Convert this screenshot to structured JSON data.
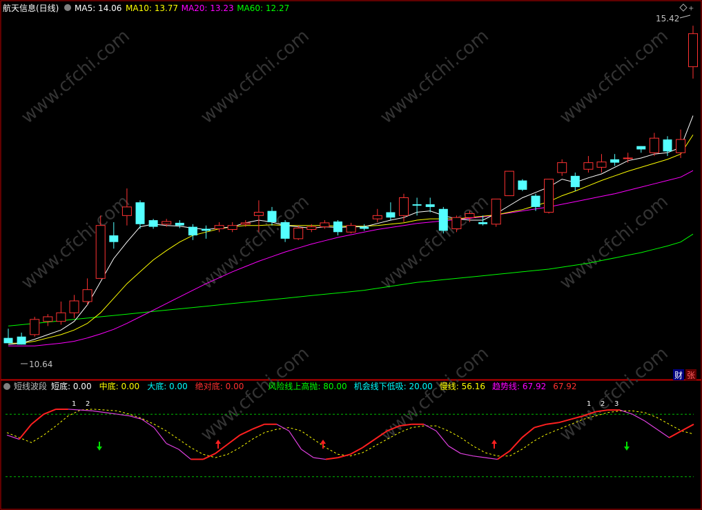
{
  "main_panel": {
    "title": "航天信息",
    "period": "(日线)",
    "ma_labels": [
      {
        "text": "MA5: 14.06",
        "color": "#ffffff"
      },
      {
        "text": "MA10: 13.77",
        "color": "#ffff00"
      },
      {
        "text": "MA20: 13.23",
        "color": "#ff00ff"
      },
      {
        "text": "MA60: 12.27",
        "color": "#00ff00"
      }
    ],
    "high_label": "15.42",
    "low_label": "10.64",
    "side_buttons": [
      "财",
      "张"
    ]
  },
  "sub_panel": {
    "title": "短线波段",
    "indicators": [
      {
        "text": "短底: 0.00",
        "color": "#ffffff"
      },
      {
        "text": "中底: 0.00",
        "color": "#ffff00"
      },
      {
        "text": "大底: 0.00",
        "color": "#00ffff"
      },
      {
        "text": "绝对底: 0.00",
        "color": "#ff3030"
      },
      {
        "text": "风险线上高抛: 80.00",
        "color": "#00ff00"
      },
      {
        "text": "机会线下低吸: 20.00",
        "color": "#00ffff"
      },
      {
        "text": "慢线: 56.16",
        "color": "#ffff00"
      },
      {
        "text": "趋势线: 67.92",
        "color": "#ff00ff"
      },
      {
        "text": "67.92",
        "color": "#ff3030"
      }
    ],
    "labels": [
      "1",
      "2",
      "1",
      "2",
      "3"
    ]
  },
  "watermark": "www.cfchi.com",
  "chart_data": {
    "type": "candlestick",
    "y_range": [
      10.3,
      15.6
    ],
    "candles": [
      [
        10.7,
        10.62,
        10.62,
        10.84
      ],
      [
        10.72,
        10.6,
        10.6,
        10.78
      ],
      [
        10.75,
        10.98,
        10.72,
        11.02
      ],
      [
        10.95,
        11.02,
        10.88,
        11.06
      ],
      [
        10.95,
        11.08,
        10.9,
        11.25
      ],
      [
        11.08,
        11.26,
        11.0,
        11.35
      ],
      [
        11.25,
        11.43,
        11.2,
        11.6
      ],
      [
        11.6,
        12.4,
        11.6,
        12.55
      ],
      [
        12.25,
        12.15,
        12.05,
        12.45
      ],
      [
        12.55,
        12.68,
        12.4,
        12.96
      ],
      [
        12.75,
        12.42,
        12.35,
        12.78
      ],
      [
        12.48,
        12.38,
        12.35,
        12.5
      ],
      [
        12.42,
        12.46,
        12.38,
        12.5
      ],
      [
        12.44,
        12.4,
        12.36,
        12.48
      ],
      [
        12.38,
        12.25,
        12.18,
        12.42
      ],
      [
        12.35,
        12.32,
        12.2,
        12.4
      ],
      [
        12.35,
        12.4,
        12.3,
        12.45
      ],
      [
        12.34,
        12.4,
        12.3,
        12.45
      ],
      [
        12.42,
        12.44,
        12.38,
        12.48
      ],
      [
        12.55,
        12.6,
        12.3,
        12.78
      ],
      [
        12.62,
        12.45,
        12.4,
        12.68
      ],
      [
        12.45,
        12.2,
        12.15,
        12.48
      ],
      [
        12.2,
        12.36,
        12.18,
        12.4
      ],
      [
        12.34,
        12.38,
        12.3,
        12.42
      ],
      [
        12.38,
        12.44,
        12.35,
        12.48
      ],
      [
        12.46,
        12.3,
        12.25,
        12.48
      ],
      [
        12.3,
        12.4,
        12.28,
        12.44
      ],
      [
        12.38,
        12.35,
        12.32,
        12.42
      ],
      [
        12.5,
        12.55,
        12.45,
        12.65
      ],
      [
        12.6,
        12.52,
        12.48,
        12.75
      ],
      [
        12.55,
        12.82,
        12.45,
        12.88
      ],
      [
        12.72,
        12.7,
        12.55,
        12.82
      ],
      [
        12.72,
        12.68,
        12.6,
        12.82
      ],
      [
        12.65,
        12.32,
        12.28,
        12.68
      ],
      [
        12.35,
        12.52,
        12.3,
        12.55
      ],
      [
        12.52,
        12.58,
        12.45,
        12.62
      ],
      [
        12.45,
        12.42,
        12.4,
        12.55
      ],
      [
        12.42,
        12.8,
        12.38,
        12.8
      ],
      [
        12.85,
        13.22,
        12.85,
        13.22
      ],
      [
        13.08,
        12.94,
        12.92,
        13.1
      ],
      [
        12.85,
        12.68,
        12.62,
        12.88
      ],
      [
        12.6,
        13.1,
        12.58,
        13.1
      ],
      [
        13.2,
        13.35,
        13.15,
        13.4
      ],
      [
        13.15,
        12.98,
        12.92,
        13.2
      ],
      [
        13.25,
        13.35,
        13.2,
        13.45
      ],
      [
        13.28,
        13.36,
        13.2,
        13.48
      ],
      [
        13.4,
        13.35,
        13.3,
        13.48
      ],
      [
        13.42,
        13.42,
        13.35,
        13.5
      ],
      [
        13.6,
        13.55,
        13.5,
        13.6
      ],
      [
        13.5,
        13.72,
        13.45,
        13.8
      ],
      [
        13.7,
        13.52,
        13.45,
        13.75
      ],
      [
        13.5,
        13.7,
        13.42,
        13.85
      ],
      [
        14.8,
        15.3,
        14.62,
        15.42
      ]
    ],
    "ma5": [
      10.6,
      10.62,
      10.68,
      10.75,
      10.82,
      10.95,
      11.2,
      11.55,
      11.9,
      12.15,
      12.38,
      12.42,
      12.4,
      12.39,
      12.36,
      12.34,
      12.36,
      12.38,
      12.44,
      12.48,
      12.45,
      12.4,
      12.38,
      12.36,
      12.38,
      12.37,
      12.38,
      12.38,
      12.43,
      12.48,
      12.52,
      12.6,
      12.62,
      12.55,
      12.5,
      12.48,
      12.48,
      12.58,
      12.7,
      12.82,
      12.9,
      12.98,
      13.1,
      13.05,
      13.12,
      13.18,
      13.28,
      13.38,
      13.42,
      13.48,
      13.5,
      13.58,
      14.06
    ],
    "ma10": [
      10.62,
      10.62,
      10.65,
      10.7,
      10.75,
      10.82,
      10.92,
      11.08,
      11.3,
      11.52,
      11.7,
      11.88,
      12.02,
      12.15,
      12.25,
      12.3,
      12.35,
      12.38,
      12.4,
      12.4,
      12.41,
      12.4,
      12.4,
      12.4,
      12.4,
      12.39,
      12.39,
      12.39,
      12.4,
      12.42,
      12.44,
      12.48,
      12.5,
      12.5,
      12.5,
      12.52,
      12.54,
      12.56,
      12.6,
      12.64,
      12.7,
      12.76,
      12.85,
      12.92,
      13.0,
      13.08,
      13.15,
      13.22,
      13.28,
      13.34,
      13.4,
      13.48,
      13.77
    ],
    "ma20": [
      10.58,
      10.58,
      10.58,
      10.6,
      10.62,
      10.65,
      10.7,
      10.76,
      10.83,
      10.92,
      11.02,
      11.12,
      11.22,
      11.32,
      11.42,
      11.52,
      11.61,
      11.7,
      11.78,
      11.86,
      11.93,
      12.0,
      12.06,
      12.12,
      12.17,
      12.22,
      12.26,
      12.3,
      12.34,
      12.37,
      12.4,
      12.43,
      12.45,
      12.47,
      12.49,
      12.51,
      12.53,
      12.56,
      12.59,
      12.62,
      12.65,
      12.68,
      12.72,
      12.76,
      12.8,
      12.84,
      12.88,
      12.93,
      12.98,
      13.03,
      13.08,
      13.13,
      13.23
    ],
    "ma60": [
      10.88,
      10.9,
      10.92,
      10.94,
      10.96,
      10.98,
      11.0,
      11.02,
      11.04,
      11.06,
      11.08,
      11.1,
      11.12,
      11.14,
      11.16,
      11.18,
      11.2,
      11.22,
      11.24,
      11.26,
      11.28,
      11.3,
      11.32,
      11.34,
      11.36,
      11.38,
      11.4,
      11.42,
      11.45,
      11.48,
      11.51,
      11.54,
      11.56,
      11.58,
      11.6,
      11.62,
      11.64,
      11.66,
      11.68,
      11.7,
      11.72,
      11.74,
      11.77,
      11.8,
      11.83,
      11.87,
      11.91,
      11.95,
      11.99,
      12.04,
      12.09,
      12.15,
      12.27
    ],
    "sub_range": [
      0,
      100
    ],
    "sub_lines": {
      "upper": 80,
      "lower": 20
    },
    "trend": [
      55,
      50,
      68,
      80,
      86,
      86,
      85,
      84,
      82,
      80,
      78,
      74,
      64,
      45,
      38,
      26,
      26,
      33,
      44,
      55,
      62,
      68,
      68,
      60,
      38,
      28,
      26,
      28,
      32,
      40,
      50,
      60,
      66,
      68,
      68,
      60,
      42,
      33,
      30,
      28,
      26,
      36,
      52,
      64,
      68,
      70,
      74,
      78,
      83,
      85,
      85,
      80,
      72,
      62,
      52,
      60,
      67.92
    ],
    "slow": [
      58,
      52,
      46,
      55,
      66,
      78,
      85,
      86,
      85,
      84,
      80,
      75,
      68,
      60,
      50,
      40,
      32,
      28,
      32,
      40,
      50,
      58,
      62,
      64,
      60,
      50,
      40,
      32,
      30,
      34,
      42,
      50,
      58,
      64,
      66,
      66,
      60,
      52,
      42,
      34,
      30,
      30,
      38,
      48,
      56,
      62,
      68,
      74,
      78,
      82,
      84,
      84,
      82,
      76,
      68,
      60,
      56.16
    ]
  }
}
